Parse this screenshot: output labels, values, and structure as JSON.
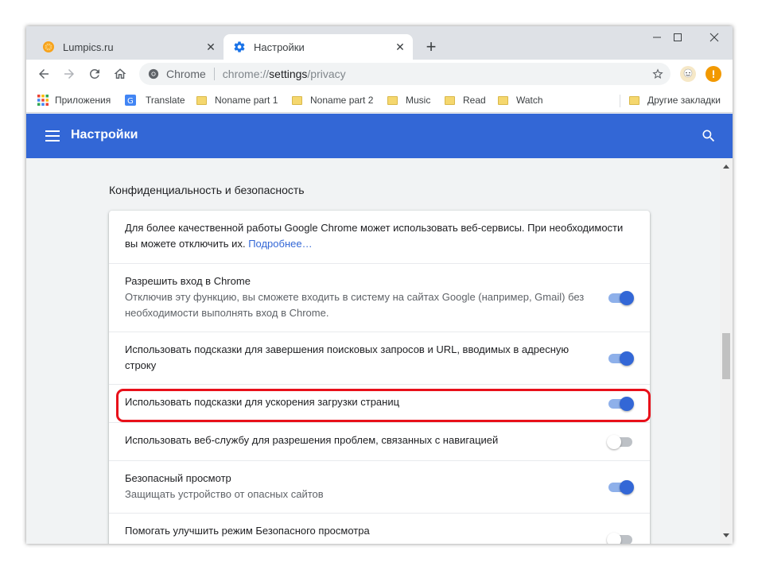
{
  "tabs": [
    {
      "title": "Lumpics.ru",
      "close": "✕"
    },
    {
      "title": "Настройки",
      "close": "✕"
    }
  ],
  "newtab_label": "+",
  "window_controls": {
    "minimize": "—",
    "maximize": "☐",
    "close": "✕"
  },
  "omnibox": {
    "scheme_label": "Chrome",
    "url_prefix": "chrome://",
    "url_host": "settings",
    "url_path": "/privacy"
  },
  "bookmarks": [
    {
      "label": "Приложения",
      "icon": "apps-grid-icon"
    },
    {
      "label": "Translate",
      "icon": "translate-icon"
    },
    {
      "label": "Noname part 1",
      "icon": "folder-icon"
    },
    {
      "label": "Noname part 2",
      "icon": "folder-icon"
    },
    {
      "label": "Music",
      "icon": "folder-icon"
    },
    {
      "label": "Read",
      "icon": "folder-icon"
    },
    {
      "label": "Watch",
      "icon": "folder-icon"
    },
    {
      "label": "Другие закладки",
      "icon": "folder-icon"
    }
  ],
  "header": {
    "title": "Настройки"
  },
  "section_title": "Конфиденциальность и безопасность",
  "intro": {
    "text": "Для более качественной работы Google Chrome может использовать веб-сервисы. При необходимости вы можете отключить их.",
    "link": "Подробнее…"
  },
  "settings": [
    {
      "title": "Разрешить вход в Chrome",
      "subtitle": "Отключив эту функцию, вы сможете входить в систему на сайтах Google (например, Gmail) без необходимости выполнять вход в Chrome.",
      "enabled": true
    },
    {
      "title": "Использовать подсказки для завершения поисковых запросов и URL, вводимых в адресную строку",
      "subtitle": "",
      "enabled": true
    },
    {
      "title": "Использовать подсказки для ускорения загрузки страниц",
      "subtitle": "",
      "enabled": true
    },
    {
      "title": "Использовать веб-службу для разрешения проблем, связанных с навигацией",
      "subtitle": "",
      "enabled": false
    },
    {
      "title": "Безопасный просмотр",
      "subtitle": "Защищать устройство от опасных сайтов",
      "enabled": true
    },
    {
      "title": "Помогать улучшить режим Безопасного просмотра",
      "subtitle": "",
      "enabled": false
    }
  ],
  "colors": {
    "accent": "#3367d6",
    "highlight": "#e8101a",
    "toggle_on_track": "#8eb0ea"
  }
}
